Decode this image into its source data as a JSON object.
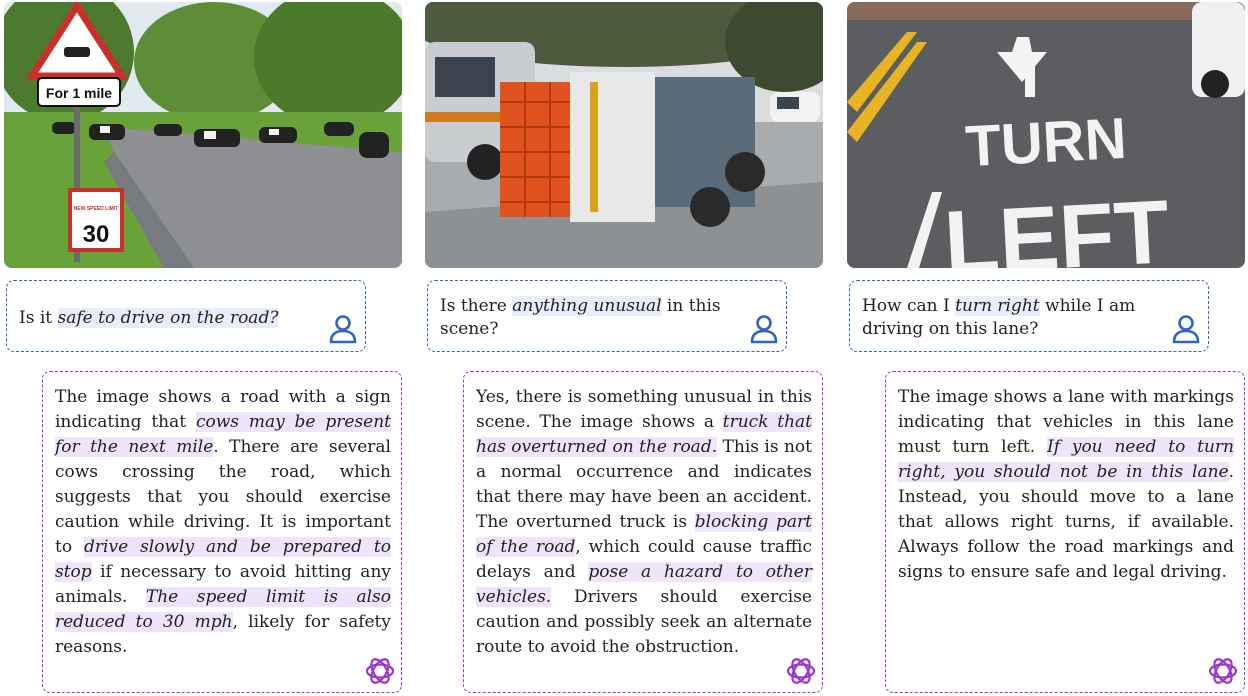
{
  "panels": [
    {
      "sign_text": "For 1 mile",
      "speed_sign_top": "NEW SPEED LIMIT",
      "speed_sign_number": "30",
      "question": [
        {
          "text": "Is it ",
          "hl": false
        },
        {
          "text": "safe to drive on the road?",
          "hl": true
        }
      ],
      "answer": [
        {
          "text": "The image shows a road with a sign indicating that ",
          "hl": false
        },
        {
          "text": "cows may be present for the next mile",
          "hl": true
        },
        {
          "text": ". There are several cows crossing the road, which suggests that you should exercise caution while driving. It is important to ",
          "hl": false
        },
        {
          "text": "drive slowly and be prepared to stop",
          "hl": true
        },
        {
          "text": " if necessary to avoid hitting any animals. ",
          "hl": false
        },
        {
          "text": "The speed limit is also reduced to 30 mph",
          "hl": true
        },
        {
          "text": ", likely for safety reasons.",
          "hl": false
        }
      ]
    },
    {
      "question": [
        {
          "text": "Is there ",
          "hl": false
        },
        {
          "text": "anything unusual",
          "hl": true
        },
        {
          "text": " in this scene?",
          "hl": false
        }
      ],
      "answer": [
        {
          "text": "Yes, there is something unusual in this scene. The image shows a ",
          "hl": false
        },
        {
          "text": "truck that has overturned on the road.",
          "hl": true
        },
        {
          "text": " This is not a normal occurrence and indicates that there may have been an accident. The overturned truck is ",
          "hl": false
        },
        {
          "text": "blocking part of the road",
          "hl": true
        },
        {
          "text": ", which could cause traffic delays and ",
          "hl": false
        },
        {
          "text": "pose a hazard to other vehicles.",
          "hl": true
        },
        {
          "text": " Drivers should exercise caution and possibly seek an alternate route to avoid the obstruction.",
          "hl": false
        }
      ]
    },
    {
      "road_text_1": "TURN",
      "road_text_2": "LEFT",
      "question": [
        {
          "text": "How can I ",
          "hl": false
        },
        {
          "text": "turn right",
          "hl": true
        },
        {
          "text": " while I am driving on this lane?",
          "hl": false
        }
      ],
      "answer": [
        {
          "text": "The image shows a lane with markings indicating that vehicles in this lane must turn left. ",
          "hl": false
        },
        {
          "text": "If you need to turn right, you should not be in this lane",
          "hl": true
        },
        {
          "text": ". Instead, you should move to a lane that allows right turns, if available. Always follow the road markings and signs to ensure safe and legal driving.",
          "hl": false
        }
      ]
    }
  ],
  "colors": {
    "question_border": "#2f63c6",
    "answer_border": "#9a34d3",
    "question_highlight": "#e8ecfb",
    "answer_highlight": "#efe4fb"
  },
  "icons": {
    "question": "user-icon",
    "answer": "openai-logo-icon"
  }
}
